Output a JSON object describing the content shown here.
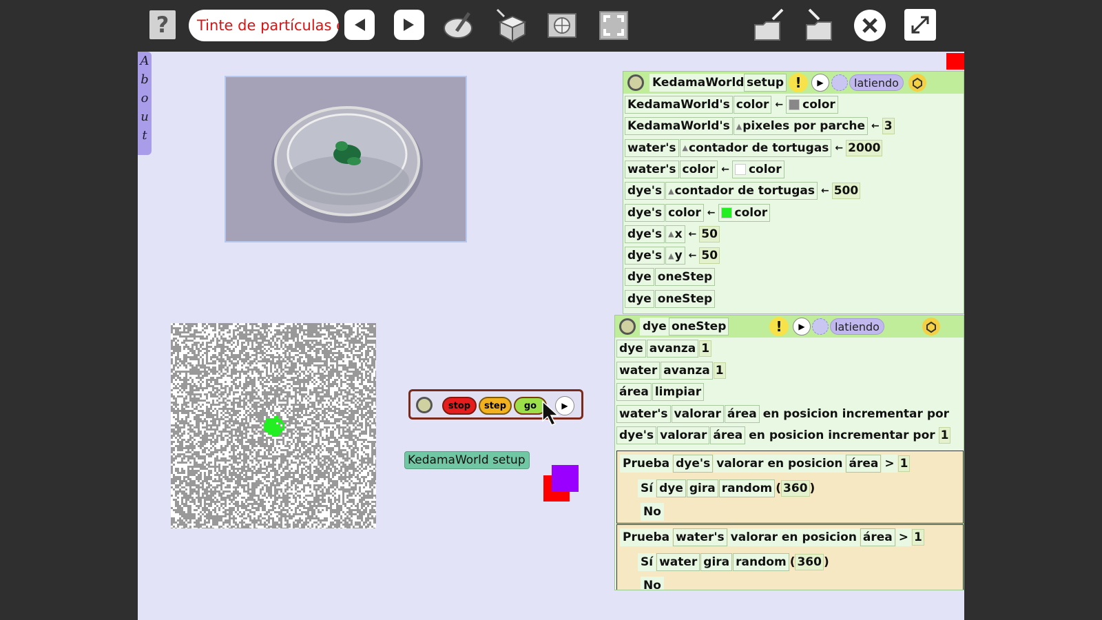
{
  "toolbar": {
    "help_label": "?",
    "project_name": "Tinte de partículas e",
    "buttons": [
      "previous-page",
      "next-page",
      "paint",
      "supplies",
      "world-globe",
      "full-screen-frame",
      "open-project",
      "open-folder",
      "close",
      "expand"
    ]
  },
  "about_flap": {
    "letters": [
      "A",
      "b",
      "o",
      "u",
      "t"
    ]
  },
  "control_panel": {
    "stop": "stop",
    "step": "step",
    "go": "go"
  },
  "kedama_label": "KedamaWorld setup",
  "colors": {
    "red": "#ff0000",
    "purple": "#9900ff",
    "black": "#000000",
    "green": "#22ee22",
    "gray": "#999999",
    "panel_bg": "#e3e3f7"
  },
  "script_setup": {
    "owner": "KedamaWorld",
    "name": "setup",
    "status": "latiendo",
    "rows": [
      {
        "subject": "KedamaWorld's",
        "slot": "color",
        "value": "color",
        "swatch": "#888888"
      },
      {
        "subject": "KedamaWorld's",
        "slot": "pixeles por parche",
        "value": "3"
      },
      {
        "subject": "water's",
        "slot": "contador de tortugas",
        "value": "2000"
      },
      {
        "subject": "water's",
        "slot": "color",
        "value": "color",
        "swatch": "#ffffff"
      },
      {
        "subject": "dye's",
        "slot": "contador de tortugas",
        "value": "500"
      },
      {
        "subject": "dye's",
        "slot": "color",
        "value": "color",
        "swatch": "#22ee22"
      },
      {
        "subject": "dye's",
        "slot": "x",
        "value": "50"
      },
      {
        "subject": "dye's",
        "slot": "y",
        "value": "50"
      },
      {
        "subject": "dye",
        "slot": "oneStep"
      },
      {
        "subject": "dye",
        "slot": "oneStep"
      }
    ]
  },
  "script_onestep": {
    "owner": "dye",
    "name": "oneStep",
    "status": "latiendo",
    "rows": [
      {
        "subject": "dye",
        "cmd": "avanza",
        "value": "1"
      },
      {
        "subject": "water",
        "cmd": "avanza",
        "value": "1"
      },
      {
        "subject": "área",
        "cmd": "limpiar"
      },
      {
        "subject": "water's",
        "cmd": "valorar",
        "arg": "área",
        "tail": "en posicion incrementar por"
      },
      {
        "subject": "dye's",
        "cmd": "valorar",
        "arg": "área",
        "tail": "en posicion incrementar por",
        "value": "1"
      }
    ],
    "tests": [
      {
        "label": "Prueba",
        "subject": "dye's",
        "expr": "valorar en posicion",
        "arg": "área",
        "op": ">",
        "value": "1",
        "yes": "Sí",
        "yes_subject": "dye",
        "yes_cmd": "gira",
        "fn": "random",
        "fn_arg": "360",
        "no": "No"
      },
      {
        "label": "Prueba",
        "subject": "water's",
        "expr": "valorar en posicion",
        "arg": "área",
        "op": ">",
        "value": "1",
        "yes": "Sí",
        "yes_subject": "water",
        "yes_cmd": "gira",
        "fn": "random",
        "fn_arg": "360",
        "no": "No"
      }
    ]
  }
}
